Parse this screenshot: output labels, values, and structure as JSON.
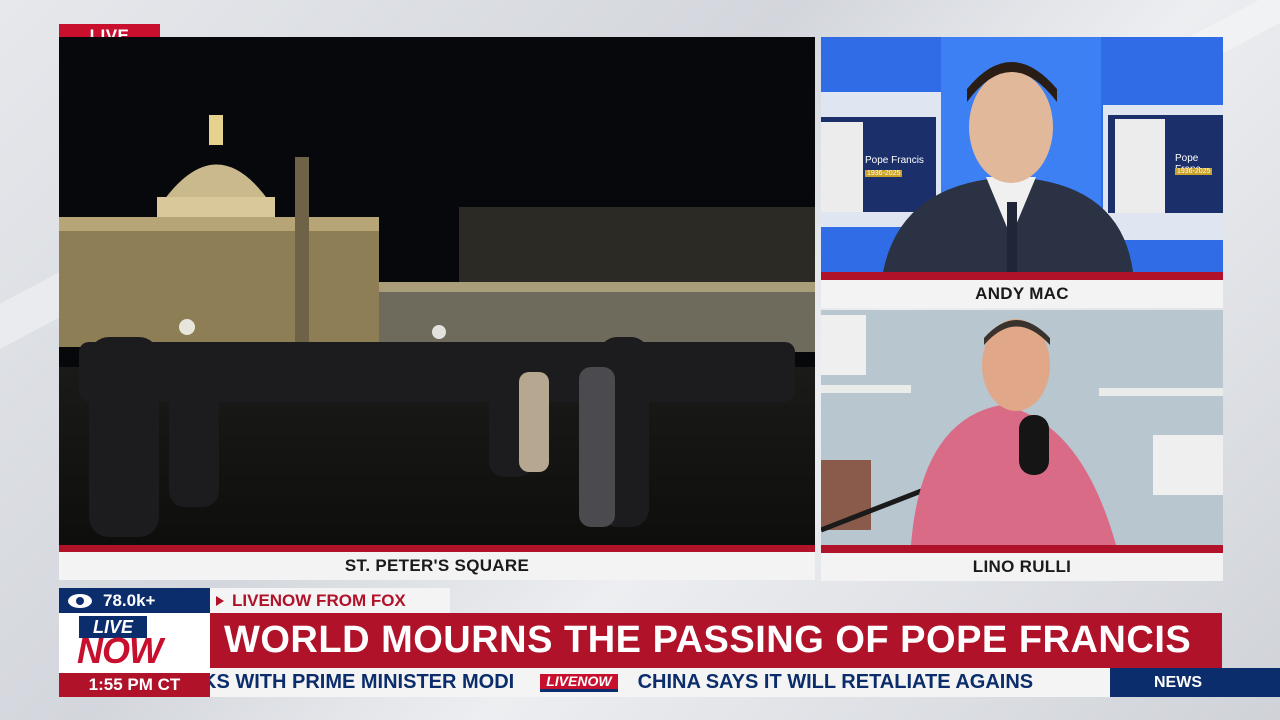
{
  "live_tag": "LIVE",
  "main_feed": {
    "caption": "ST. PETER'S SQUARE"
  },
  "top_panel": {
    "caption": "ANDY MAC",
    "monitor_left": {
      "name": "Pope Francis",
      "years": "1936-2025"
    },
    "monitor_right": {
      "name": "Pope Franc",
      "years": "1936-2025"
    }
  },
  "bottom_panel": {
    "caption": "LINO RULLI"
  },
  "lower_third": {
    "viewers": "78.0k+",
    "source": "LIVENOW FROM FOX",
    "logo_live": "LIVE",
    "logo_now": "NOW",
    "headline": "WORLD MOURNS THE PASSING OF POPE FRANCIS",
    "time": "1:55 PM CT",
    "ticker_text": "KS WITH PRIME MINISTER MODI",
    "ticker_logo": "LIVENOW",
    "ticker_text_2": "CHINA SAYS IT WILL RETALIATE AGAINS",
    "news_label": "NEWS"
  },
  "colors": {
    "brand_red": "#b0122a",
    "brand_navy": "#0c2d6b",
    "live_red": "#c8102e"
  },
  "icons": {
    "viewer_icon": "eye-icon",
    "source_icon": "play-icon"
  }
}
